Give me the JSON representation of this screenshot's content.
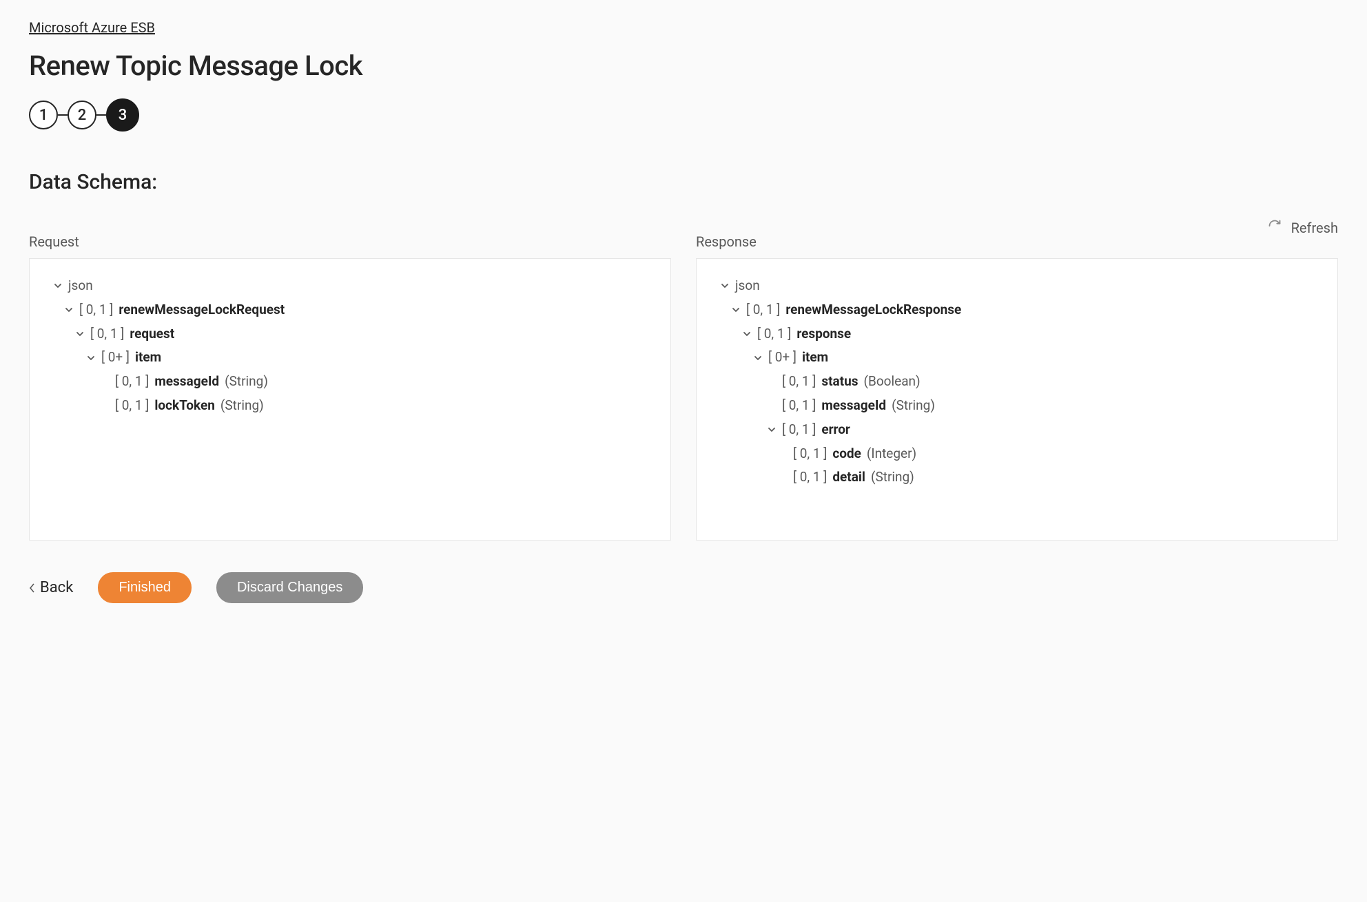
{
  "breadcrumb": "Microsoft Azure ESB",
  "title": "Renew Topic Message Lock",
  "stepper": {
    "steps": [
      "1",
      "2",
      "3"
    ],
    "activeIndex": 2
  },
  "sectionHeading": "Data Schema:",
  "refreshLabel": "Refresh",
  "panels": {
    "request": {
      "label": "Request",
      "root": "json",
      "tree": [
        {
          "indent": 1,
          "expand": true,
          "cardinality": "[ 0, 1 ]",
          "name": "renewMessageLockRequest",
          "type": ""
        },
        {
          "indent": 2,
          "expand": true,
          "cardinality": "[ 0, 1 ]",
          "name": "request",
          "type": ""
        },
        {
          "indent": 3,
          "expand": true,
          "cardinality": "[ 0+ ]",
          "name": "item",
          "type": ""
        },
        {
          "indent": 4,
          "expand": false,
          "cardinality": "[ 0, 1 ]",
          "name": "messageId",
          "type": "(String)"
        },
        {
          "indent": 4,
          "expand": false,
          "cardinality": "[ 0, 1 ]",
          "name": "lockToken",
          "type": "(String)"
        }
      ]
    },
    "response": {
      "label": "Response",
      "root": "json",
      "tree": [
        {
          "indent": 1,
          "expand": true,
          "cardinality": "[ 0, 1 ]",
          "name": "renewMessageLockResponse",
          "type": ""
        },
        {
          "indent": 2,
          "expand": true,
          "cardinality": "[ 0, 1 ]",
          "name": "response",
          "type": ""
        },
        {
          "indent": 3,
          "expand": true,
          "cardinality": "[ 0+ ]",
          "name": "item",
          "type": ""
        },
        {
          "indent": 4,
          "expand": false,
          "cardinality": "[ 0, 1 ]",
          "name": "status",
          "type": "(Boolean)"
        },
        {
          "indent": 4,
          "expand": false,
          "cardinality": "[ 0, 1 ]",
          "name": "messageId",
          "type": "(String)"
        },
        {
          "indent": 4,
          "expand": true,
          "cardinality": "[ 0, 1 ]",
          "name": "error",
          "type": ""
        },
        {
          "indent": 5,
          "expand": false,
          "cardinality": "[ 0, 1 ]",
          "name": "code",
          "type": "(Integer)"
        },
        {
          "indent": 5,
          "expand": false,
          "cardinality": "[ 0, 1 ]",
          "name": "detail",
          "type": "(String)"
        }
      ]
    }
  },
  "footer": {
    "back": "Back",
    "finished": "Finished",
    "discard": "Discard Changes"
  }
}
